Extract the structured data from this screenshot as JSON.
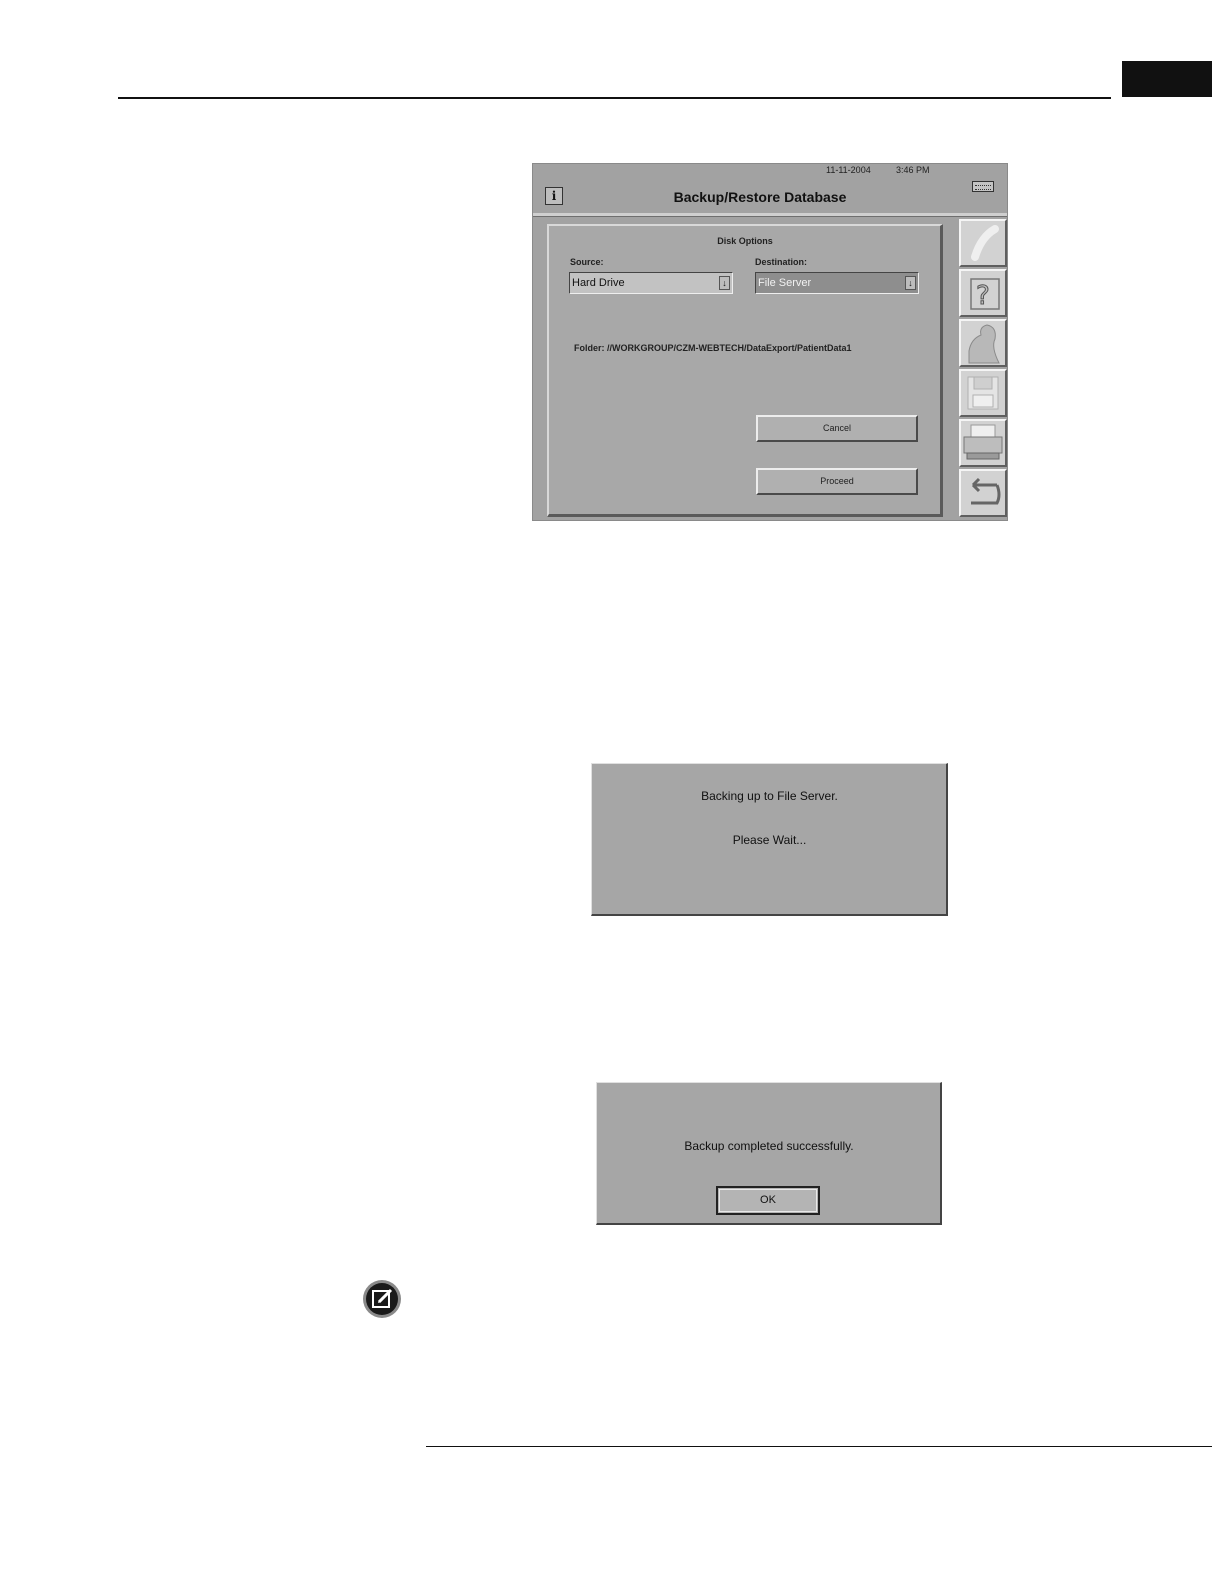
{
  "screen": {
    "date": "11-11-2004",
    "time": "3:46 PM",
    "info_icon": "info-icon",
    "title": "Backup/Restore Database",
    "keyboard_icon": "keyboard-icon",
    "panel_title": "Disk Options",
    "source_label": "Source:",
    "source_value": "Hard Drive",
    "destination_label": "Destination:",
    "destination_value": "File Server",
    "folder": "Folder: //WORKGROUP/CZM-WEBTECH/DataExport/PatientData1",
    "cancel_label": "Cancel",
    "proceed_label": "Proceed",
    "side_icons": [
      "pen-icon",
      "help-icon",
      "patient-icon",
      "disk-icon",
      "printer-icon",
      "return-icon"
    ]
  },
  "wait_dialog": {
    "line1": "Backing up to File Server.",
    "line2": "Please Wait..."
  },
  "done_dialog": {
    "message": "Backup completed successfully.",
    "ok_label": "OK"
  },
  "note": {
    "icon": "note-icon"
  },
  "colors": {
    "screen_gray": "#a2a2a2",
    "dialog_gray": "#a6a6a6",
    "tab_block": "#111111"
  }
}
